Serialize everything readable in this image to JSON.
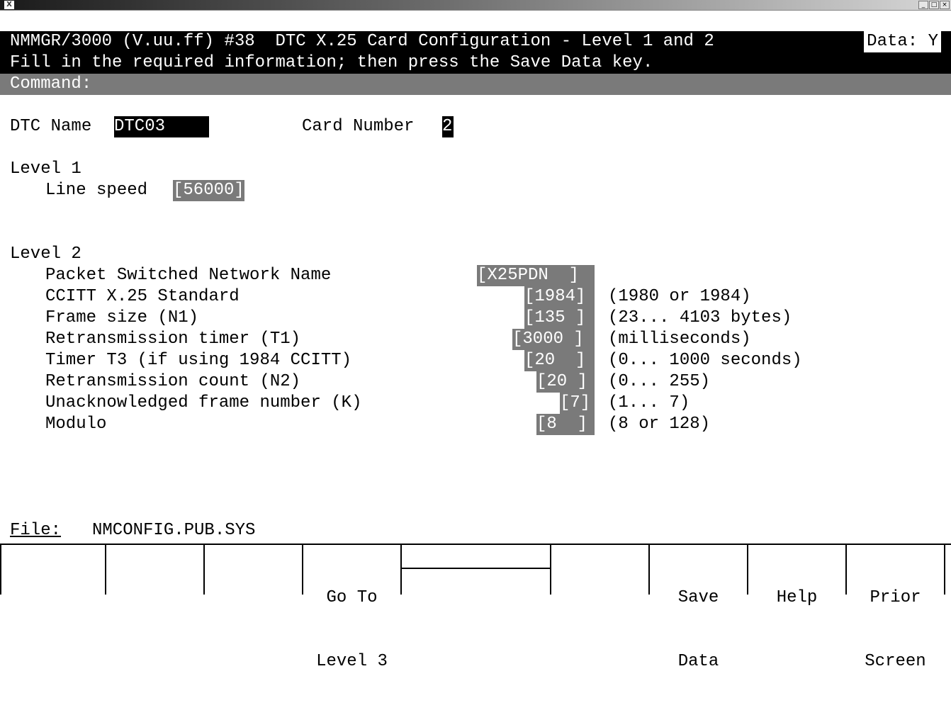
{
  "window": {
    "icon": "X",
    "controls": [
      "minimize-icon",
      "maximize-icon",
      "close-icon"
    ]
  },
  "header": {
    "line1": "NMMGR/3000 (V.uu.ff) #38  DTC X.25 Card Configuration - Level 1 and 2",
    "data_flag": "Data: Y",
    "line2": "Fill in the required information; then press the Save Data key.",
    "command_label": "Command:",
    "command_value": ""
  },
  "dtc": {
    "name_label": "DTC Name",
    "name_value": "DTC03",
    "card_label": "Card Number",
    "card_value": "2"
  },
  "level1": {
    "title": "Level 1",
    "line_speed_label": "Line speed",
    "line_speed_value": "[56000]"
  },
  "level2": {
    "title": "Level 2",
    "fields": [
      {
        "label": "Packet Switched Network Name",
        "value": "[X25PDN  ]",
        "hint": ""
      },
      {
        "label": "CCITT X.25 Standard",
        "value": "[1984]",
        "hint": "(1980 or 1984)"
      },
      {
        "label": "Frame size (N1)",
        "value": "[135 ]",
        "hint": "(23... 4103 bytes)"
      },
      {
        "label": "Retransmission timer (T1)",
        "value": "[3000 ]",
        "hint": "(milliseconds)"
      },
      {
        "label": "Timer T3 (if using 1984 CCITT)",
        "value": "[20  ]",
        "hint": "(0... 1000 seconds)"
      },
      {
        "label": "Retransmission count (N2)",
        "value": "[20 ]",
        "hint": "(0... 255)"
      },
      {
        "label": "Unacknowledged frame number (K)",
        "value": "[7]",
        "hint": "(1... 7)"
      },
      {
        "label": "Modulo",
        "value": "[8  ]",
        "hint": "(8 or 128)"
      }
    ]
  },
  "footer": {
    "file_label": "File:",
    "file_value": "NMCONFIG.PUB.SYS"
  },
  "function_keys": [
    {
      "line1": "",
      "line2": ""
    },
    {
      "line1": "",
      "line2": ""
    },
    {
      "line1": "",
      "line2": ""
    },
    {
      "line1": "Go To",
      "line2": "Level 3"
    },
    {
      "line1": "",
      "line2": ""
    },
    {
      "line1": "",
      "line2": ""
    },
    {
      "line1": "Save",
      "line2": "Data"
    },
    {
      "line1": "Help",
      "line2": ""
    },
    {
      "line1": "Prior",
      "line2": "Screen"
    }
  ]
}
